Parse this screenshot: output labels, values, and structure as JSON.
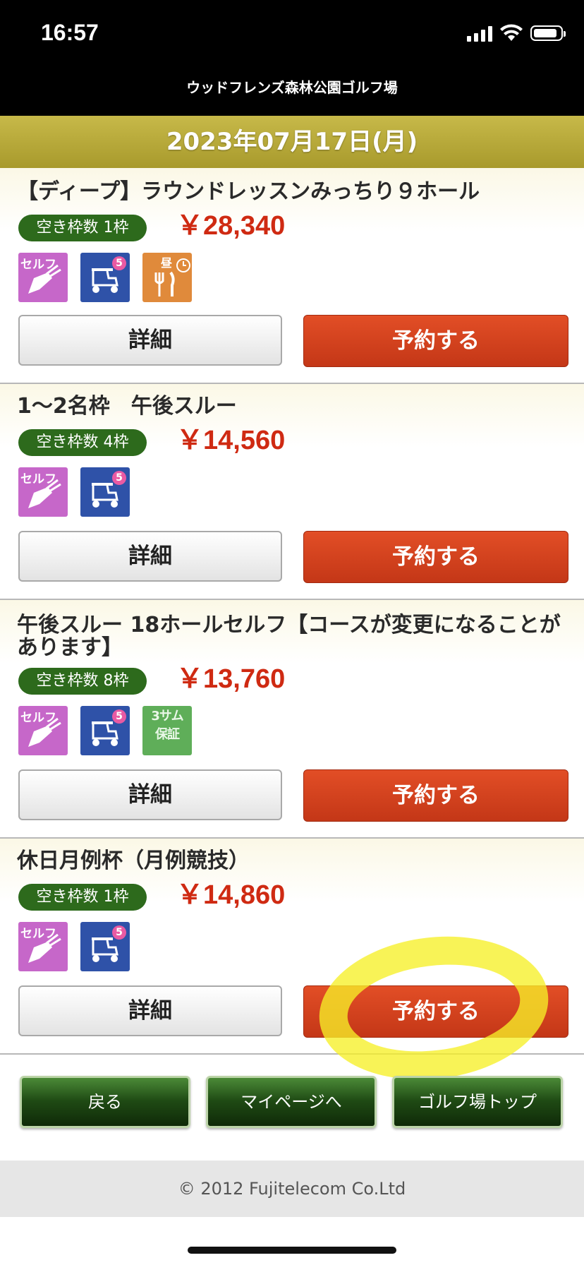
{
  "status_bar": {
    "time": "16:57"
  },
  "header": {
    "site_name": "ウッドフレンズ森林公園ゴルフ場"
  },
  "date": "2023年07月17日(月)",
  "plans": [
    {
      "title": "【ディープ】ラウンドレッスンみっちり９ホール",
      "vacancy": "空き枠数 1枠",
      "price": "￥28,340",
      "icons": [
        "self-play-icon",
        "cart-5-seater-icon",
        "lunch-icon"
      ],
      "icon_labels": {
        "self": "セルフ",
        "cart_num": "5",
        "lunch": "昼"
      },
      "detail_label": "詳細",
      "reserve_label": "予約する"
    },
    {
      "title": "1〜2名枠　午後スルー",
      "vacancy": "空き枠数 4枠",
      "price": "￥14,560",
      "icons": [
        "self-play-icon",
        "cart-5-seater-icon"
      ],
      "icon_labels": {
        "self": "セルフ",
        "cart_num": "5"
      },
      "detail_label": "詳細",
      "reserve_label": "予約する"
    },
    {
      "title": "午後スルー 18ホールセルフ【コースが変更になることがあります】",
      "vacancy": "空き枠数 8枠",
      "price": "￥13,760",
      "icons": [
        "self-play-icon",
        "cart-5-seater-icon",
        "threesome-guarantee-icon"
      ],
      "icon_labels": {
        "self": "セルフ",
        "cart_num": "5",
        "three_top": "3サム",
        "three_bottom": "保証"
      },
      "detail_label": "詳細",
      "reserve_label": "予約する"
    },
    {
      "title": "休日月例杯（月例競技）",
      "vacancy": "空き枠数 1枠",
      "price": "￥14,860",
      "icons": [
        "self-play-icon",
        "cart-5-seater-icon"
      ],
      "icon_labels": {
        "self": "セルフ",
        "cart_num": "5"
      },
      "detail_label": "詳細",
      "reserve_label": "予約する"
    }
  ],
  "nav": {
    "back": "戻る",
    "mypage": "マイページへ",
    "golf_top": "ゴルフ場トップ"
  },
  "footer": "© 2012 Fujitelecom Co.Ltd",
  "colors": {
    "price": "#cf2a12",
    "badge": "#2d6a1c",
    "reserve": "#d4411d",
    "highlight": "#f6f028",
    "date_bar": "#b8aa3a"
  }
}
